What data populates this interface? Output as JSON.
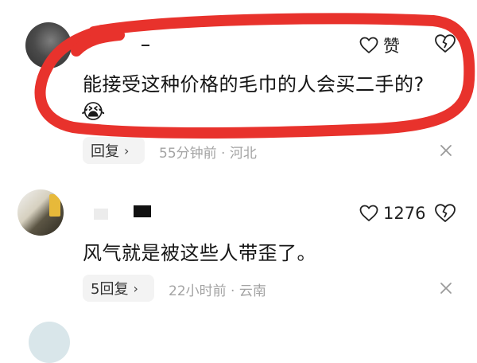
{
  "comments": [
    {
      "text": "能接受这种价格的毛巾的人会买二手的?",
      "emoji": "😭",
      "like_label": "赞",
      "reply_label": "回复",
      "reply_chevron": "›",
      "meta": "55分钟前 · 河北"
    },
    {
      "text": "风气就是被这些人带歪了。",
      "like_label": "1276",
      "reply_label": "5回复",
      "reply_chevron": "›",
      "meta": "22小时前 · 云南"
    }
  ],
  "colors": {
    "highlight_stroke": "#e8322c",
    "meta_text": "#a3a3a3",
    "pill_bg": "#f3f3f3"
  },
  "icons": [
    "heart-outline-icon",
    "broken-heart-icon",
    "close-icon",
    "chevron-right-icon"
  ]
}
